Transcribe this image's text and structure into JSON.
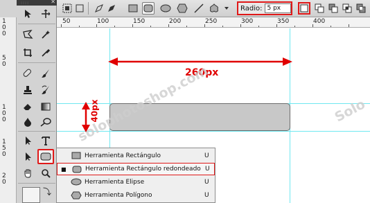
{
  "options_bar": {
    "radius_label": "Radio:",
    "radius_value": "5 px"
  },
  "vertical_ruler": [
    "1",
    "0",
    "0",
    "5",
    "0",
    "1",
    "0",
    "0",
    "1",
    "5",
    "0",
    "2",
    "0"
  ],
  "horizontal_ruler": [
    "50",
    "100",
    "150",
    "200",
    "250",
    "300",
    "350",
    "400"
  ],
  "canvas": {
    "width_label": "260px",
    "height_label": "40px",
    "watermark": "solophotoshop.com",
    "watermark_right": "Solo",
    "colors": {
      "annotation": "#e00000",
      "guide": "#6fe8f0",
      "shape_fill": "#c8c8c8"
    }
  },
  "flyout_menu": {
    "items": [
      {
        "label": "Herramienta Rectángulo",
        "shortcut": "U",
        "bullet": "",
        "icon": "rectangle-icon"
      },
      {
        "label": "Herramienta Rectángulo redondeado",
        "shortcut": "U",
        "bullet": "■",
        "icon": "rounded-rectangle-icon"
      },
      {
        "label": "Herramienta Elipse",
        "shortcut": "U",
        "bullet": "",
        "icon": "ellipse-icon"
      },
      {
        "label": "Herramienta Polígono",
        "shortcut": "U",
        "bullet": "",
        "icon": "polygon-icon"
      }
    ]
  }
}
